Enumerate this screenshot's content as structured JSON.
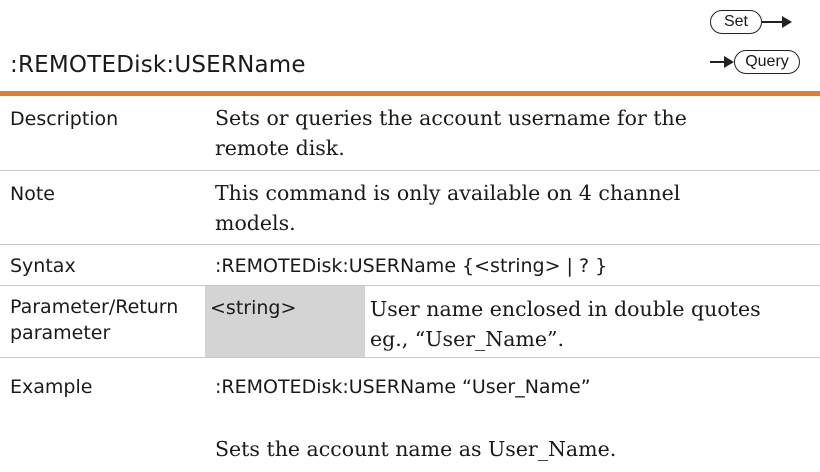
{
  "header": {
    "title": ":REMOTEDisk:USERName",
    "set_label": "Set",
    "query_label": "Query"
  },
  "rows": {
    "description": {
      "label": "Description",
      "text_line1": "Sets or queries the account username for the",
      "text_line2": "remote disk."
    },
    "note": {
      "label": "Note",
      "text_line1": "This command is only available on 4 channel",
      "text_line2": "models."
    },
    "syntax": {
      "label": "Syntax",
      "text": ":REMOTEDisk:USERName {<string> | ? }"
    },
    "parameter": {
      "label_line1": "Parameter/Return",
      "label_line2": "parameter",
      "name": "<string>",
      "desc_line1": "User name enclosed in double quotes",
      "desc_line2": "eg., “User_Name”."
    },
    "example": {
      "label": "Example",
      "command": ":REMOTEDisk:USERName “User_Name”",
      "result": "Sets the account name as User_Name."
    }
  },
  "colors": {
    "accent_rule": "#e17d2e",
    "param_cell_bg": "#d4d4d4"
  }
}
